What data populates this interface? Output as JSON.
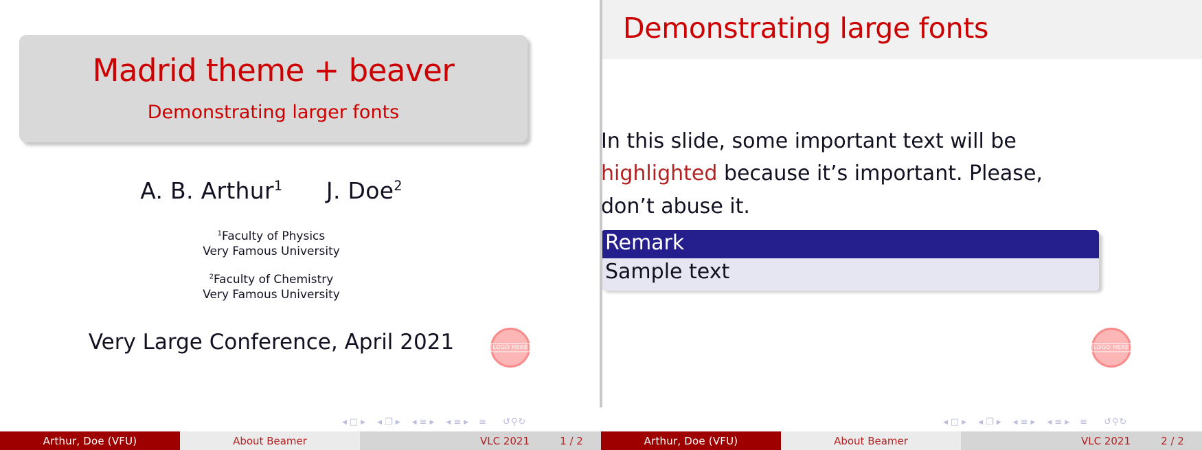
{
  "slide_title": {
    "title": "Madrid theme + beaver",
    "subtitle": "Demonstrating larger fonts",
    "author_1": "A. B. Arthur",
    "author_1_mark": "1",
    "author_2": "J. Doe",
    "author_2_mark": "2",
    "affiliation_1_mark": "1",
    "affiliation_1_line1": "Faculty of Physics",
    "affiliation_1_line2": "Very Famous University",
    "affiliation_2_mark": "2",
    "affiliation_2_line1": "Faculty of Chemistry",
    "affiliation_2_line2": "Very Famous University",
    "conference": "Very Large Conference, April 2021",
    "logo_text": "LOGO HERE",
    "footer": {
      "author": "Arthur, Doe  (VFU)",
      "title": "About Beamer",
      "date": "VLC 2021",
      "page": "1 / 2"
    }
  },
  "slide_content": {
    "frame_title": "Demonstrating large fonts",
    "paragraph_part_1": "In this slide, some important text will be ",
    "paragraph_highlight": "highlighted",
    "paragraph_part_2": " because it’s important. Please, don’t abuse it.",
    "block_title": "Remark",
    "block_body": "Sample text",
    "logo_text": "LOGO HERE",
    "footer": {
      "author": "Arthur, Doe  (VFU)",
      "title": "About Beamer",
      "date": "VLC 2021",
      "page": "2 / 2"
    }
  },
  "nav_symbols": {
    "left_arrow": "◀",
    "right_arrow": "▶",
    "slide_glyph": "□",
    "frames_glyph": "❐",
    "section_glyph": "≡",
    "subsection_glyph": "≡",
    "doc_glyph": "≡",
    "back_glyph": "↺",
    "search_glyph": "⚲",
    "forward_glyph": "↻"
  },
  "colors": {
    "beamer_red": "#cc0000",
    "footer_red": "#9e0000",
    "block_navy": "#241f8c",
    "block_body_bg": "#e6e6f2",
    "title_box_bg": "#d9d9d9",
    "head_band_bg": "#f1f1f1",
    "logo_pink": "#fcb6b6",
    "nav_lavender": "#b9bbdd"
  }
}
